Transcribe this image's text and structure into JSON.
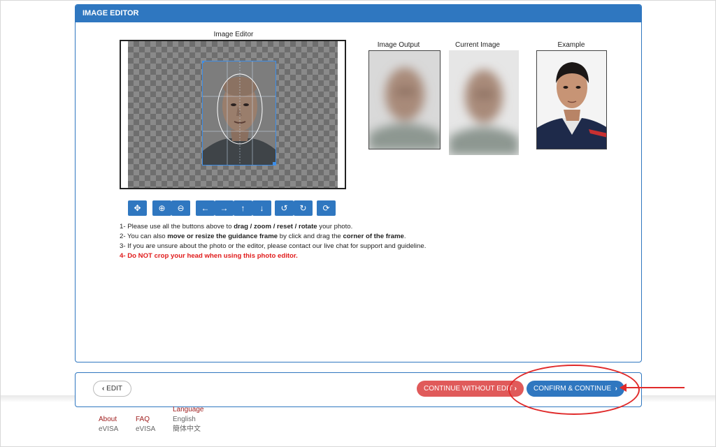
{
  "panel": {
    "title": "IMAGE EDITOR"
  },
  "captions": {
    "editor": "Image Editor",
    "output": "Image Output",
    "current": "Current Image",
    "example": "Example"
  },
  "toolbar": {
    "buttons": [
      {
        "name": "move",
        "glyph": "✥"
      },
      {
        "name": "zoom-in",
        "glyph": "⊕"
      },
      {
        "name": "zoom-out",
        "glyph": "⊖"
      },
      {
        "name": "left",
        "glyph": "←"
      },
      {
        "name": "right",
        "glyph": "→"
      },
      {
        "name": "up",
        "glyph": "↑"
      },
      {
        "name": "down",
        "glyph": "↓"
      },
      {
        "name": "rotate-left",
        "glyph": "↺"
      },
      {
        "name": "rotate-right",
        "glyph": "↻"
      },
      {
        "name": "reset",
        "glyph": "⟳"
      }
    ]
  },
  "instructions": {
    "l1_a": "1- Please use all the buttons above to ",
    "l1_b": "drag / zoom / reset / rotate",
    "l1_c": " your photo.",
    "l2_a": "2- You can also ",
    "l2_b": "move or resize the guidance frame",
    "l2_c": " by click and drag the ",
    "l2_d": "corner of the frame",
    "l2_e": ".",
    "l3": "3- If you are unsure about the photo or the editor, please contact our live chat for support and guideline.",
    "l4_a": "4- ",
    "l4_b": "Do NOT crop your head when using this photo editor."
  },
  "nav": {
    "edit_label": "EDIT",
    "edit_chevron": "‹",
    "continue_without_label": "CONTINUE WITHOUT EDIT",
    "confirm_label": "CONFIRM & CONTINUE",
    "chevron": "›"
  },
  "footer": {
    "about": "About",
    "about_sub": "eVISA",
    "faq": "FAQ",
    "faq_sub": "eVISA",
    "language_heading": "Language",
    "lang_english": "English",
    "lang_chinese": "簡体中文"
  },
  "colors": {
    "primary": "#2f77c0",
    "danger_button": "#e05a5a",
    "warning_text": "#e01b1b",
    "annotation": "#e02a2a"
  }
}
